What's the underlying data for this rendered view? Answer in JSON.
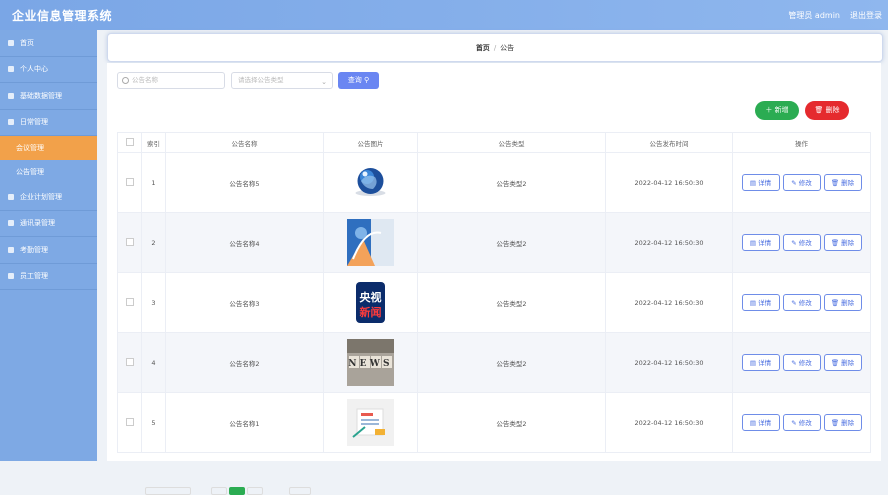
{
  "app": {
    "title": "企业信息管理系统",
    "admin": "管理员 admin",
    "logout": "退出登录"
  },
  "sidebar": {
    "items": [
      {
        "label": "首页",
        "icon": "home-icon"
      },
      {
        "label": "个人中心",
        "icon": "user-icon"
      },
      {
        "label": "基础数据管理",
        "icon": "folder-icon"
      },
      {
        "label": "日常管理",
        "icon": "calendar-icon"
      }
    ],
    "subs": [
      {
        "label": "会议管理",
        "active": true
      },
      {
        "label": "公告管理",
        "active": false
      }
    ],
    "items2": [
      {
        "label": "企业计划管理",
        "icon": "shield-icon"
      },
      {
        "label": "通讯录管理",
        "icon": "book-icon"
      },
      {
        "label": "考勤管理",
        "icon": "clock-icon"
      },
      {
        "label": "员工管理",
        "icon": "list-icon"
      }
    ]
  },
  "breadcrumb": {
    "home": "首页",
    "sep": "/",
    "current": "公告"
  },
  "search": {
    "name_placeholder": "公告名称",
    "type_placeholder": "请选择公告类型",
    "query": "查询"
  },
  "actions": {
    "add": "新增",
    "delete": "删除"
  },
  "table": {
    "headers": [
      "索引",
      "公告名称",
      "公告图片",
      "公告类型",
      "公告发布时间",
      "操作"
    ],
    "rows": [
      {
        "index": "1",
        "name": "公告名称5",
        "type": "公告类型2",
        "time": "2022-04-12 16:50:30",
        "image": "globe"
      },
      {
        "index": "2",
        "name": "公告名称4",
        "type": "公告类型2",
        "time": "2022-04-12 16:50:30",
        "image": "abstract"
      },
      {
        "index": "3",
        "name": "公告名称3",
        "type": "公告类型2",
        "time": "2022-04-12 16:50:30",
        "image": "cctv-news"
      },
      {
        "index": "4",
        "name": "公告名称2",
        "type": "公告类型2",
        "time": "2022-04-12 16:50:30",
        "image": "news-blocks"
      },
      {
        "index": "5",
        "name": "公告名称1",
        "type": "公告类型2",
        "time": "2022-04-12 16:50:30",
        "image": "news-illustration"
      }
    ],
    "ops": {
      "detail": "详情",
      "edit": "修改",
      "delete": "删除"
    }
  },
  "images": {
    "cctv_line1": "央视",
    "cctv_line2": "新闻",
    "news_word": "NEWS"
  },
  "colors": {
    "sidebar": "#7ea9e4",
    "active": "#f2a14a",
    "primary": "#6a86f2",
    "success": "#2bac52",
    "danger": "#e52a2e"
  }
}
